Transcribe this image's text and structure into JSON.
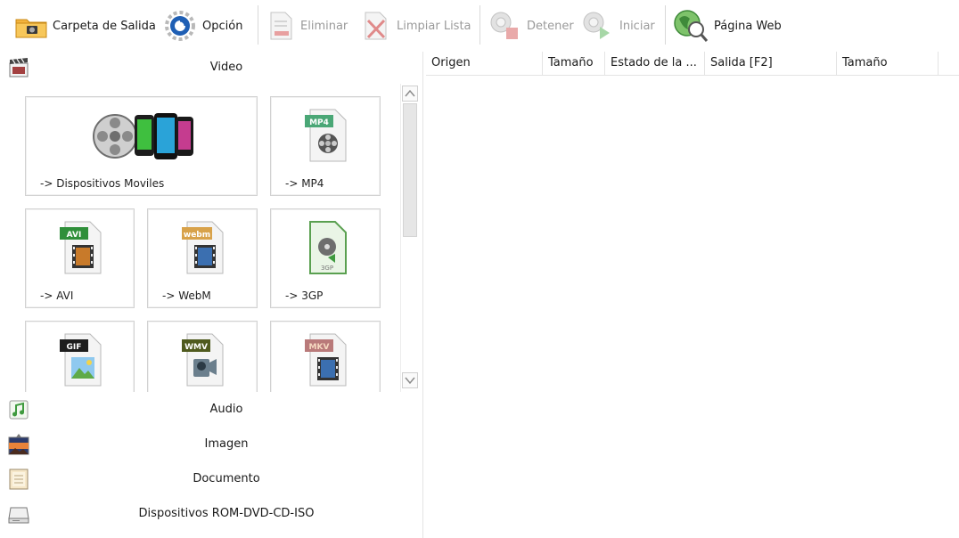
{
  "toolbar": {
    "buttons": [
      {
        "label": "Carpeta de Salida",
        "icon": "folder-icon",
        "enabled": true
      },
      {
        "label": "Opción",
        "icon": "gear-icon",
        "enabled": true
      },
      {
        "label": "Eliminar",
        "icon": "delete-file-icon",
        "enabled": false
      },
      {
        "label": "Limpiar Lista",
        "icon": "clear-list-icon",
        "enabled": false
      },
      {
        "label": "Detener",
        "icon": "stop-icon",
        "enabled": false
      },
      {
        "label": "Iniciar",
        "icon": "start-icon",
        "enabled": false
      },
      {
        "label": "Página Web",
        "icon": "globe-icon",
        "enabled": true
      }
    ]
  },
  "left_panel": {
    "video_category": {
      "label": "Video",
      "icon": "clapperboard-icon"
    },
    "tiles": [
      {
        "label": "-> Dispositivos Moviles",
        "icon": "mobile-devices-icon"
      },
      {
        "label": "-> MP4",
        "badge": "MP4",
        "icon": "mp4-file-icon"
      },
      {
        "label": "-> AVI",
        "badge": "AVI",
        "icon": "avi-file-icon"
      },
      {
        "label": "-> WebM",
        "badge": "webm",
        "icon": "webm-file-icon"
      },
      {
        "label": "-> 3GP",
        "badge": "3GP",
        "icon": "3gp-file-icon"
      },
      {
        "label": "",
        "badge": "GIF",
        "icon": "gif-file-icon"
      },
      {
        "label": "",
        "badge": "WMV",
        "icon": "wmv-file-icon"
      },
      {
        "label": "",
        "badge": "MKV",
        "icon": "mkv-file-icon"
      }
    ],
    "categories": [
      {
        "label": "Audio",
        "icon": "music-note-icon"
      },
      {
        "label": "Imagen",
        "icon": "picture-icon"
      },
      {
        "label": "Documento",
        "icon": "document-icon"
      },
      {
        "label": "Dispositivos ROM-DVD-CD-ISO",
        "icon": "disc-drive-icon"
      }
    ]
  },
  "file_list": {
    "columns": [
      "Origen",
      "Tamaño",
      "Estado de la ...",
      "Salida [F2]",
      "Tamaño"
    ]
  }
}
